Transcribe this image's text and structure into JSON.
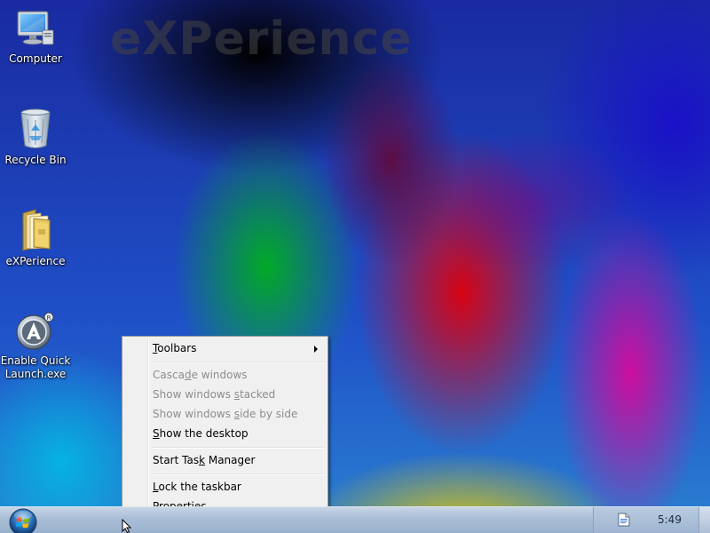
{
  "wallpaper": {
    "logo_text": "eXPerience"
  },
  "desktop_icons": [
    {
      "label": "Computer",
      "icon": "computer-icon"
    },
    {
      "label": "Recycle Bin",
      "icon": "recycle-bin-icon"
    },
    {
      "label": "eXPerience",
      "icon": "folder-icon"
    },
    {
      "label_line1": "Enable Quick",
      "label_line2": "Launch.exe",
      "icon": "quick-launch-app-icon"
    }
  ],
  "context_menu": {
    "items": [
      {
        "pre": "",
        "key": "T",
        "post": "oolbars",
        "enabled": true,
        "has_submenu": true
      },
      {
        "pre": "Casca",
        "key": "d",
        "post": "e windows",
        "enabled": false
      },
      {
        "pre": "Show windows ",
        "key": "s",
        "post": "tacked",
        "enabled": false
      },
      {
        "pre": "Show windows ",
        "key": "s",
        "post": "ide by side",
        "enabled": false
      },
      {
        "pre": "",
        "key": "S",
        "post": "how the desktop",
        "enabled": true
      },
      {
        "pre": "Start Tas",
        "key": "k",
        "post": " Manager",
        "enabled": true
      },
      {
        "pre": "",
        "key": "L",
        "post": "ock the taskbar",
        "enabled": true
      },
      {
        "pre": "P",
        "key": "r",
        "post": "operties",
        "enabled": true
      }
    ]
  },
  "taskbar": {
    "start_icon": "windows-orb-icon",
    "tray_icon": "document-icon",
    "clock": "5:49"
  },
  "colors": {
    "menu_background": "#f0f0f0",
    "menu_border": "#979797",
    "disabled_text": "#8d8d8d",
    "taskbar_top": "#c7d5e6",
    "taskbar_bottom": "#9ab1cd"
  }
}
